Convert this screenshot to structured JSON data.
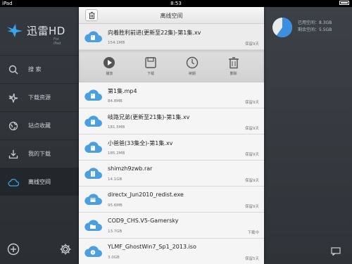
{
  "status_bar": {
    "device": "iPad",
    "time": "8:53"
  },
  "app": {
    "name": "迅雷HD",
    "subtitle": "For iPad"
  },
  "nav": [
    {
      "label": "搜    索",
      "icon": "search-icon"
    },
    {
      "label": "下载资源",
      "icon": "bird-icon"
    },
    {
      "label": "站点收藏",
      "icon": "globe-icon"
    },
    {
      "label": "我的下载",
      "icon": "download-icon"
    },
    {
      "label": "离线空间",
      "icon": "cloud-icon",
      "active": true
    }
  ],
  "storage": {
    "used_label": "已用空间：8.3GB",
    "free_label": "剩余空间：5.5GB",
    "used_fraction": 0.6
  },
  "panel": {
    "title": "离线空间",
    "actions": [
      {
        "label": "播放",
        "icon": "play-icon"
      },
      {
        "label": "下载",
        "icon": "save-icon"
      },
      {
        "label": "续期",
        "icon": "clock-icon"
      },
      {
        "label": "删除",
        "icon": "trash-icon"
      }
    ],
    "files": [
      {
        "name": "向着胜利前进(更新至22集)-第1集.xv",
        "size": "154.1MB",
        "status": "保留9天",
        "type": "video"
      },
      {
        "name": "第1集.mp4",
        "size": "84.8MB",
        "status": "保留9天",
        "type": "video"
      },
      {
        "name": "岐路兄弟(更新至21集)-第1集.xv",
        "size": "181.5MB",
        "status": "保留9天",
        "type": "video"
      },
      {
        "name": "小爸爸(33集全)-第1集.xv",
        "size": "185.2MB",
        "status": "保留9天",
        "type": "video"
      },
      {
        "name": "shimzh9zwb.rar",
        "size": "14.1GB",
        "status": "保留9天",
        "type": "archive"
      },
      {
        "name": "directx_Jun2010_redist.exe",
        "size": "95.6MB",
        "status": "保留9天",
        "type": "exe"
      },
      {
        "name": "COD9_CHS.V5-Gamersky",
        "size": "13.7GB",
        "status": "下载中",
        "type": "folder"
      },
      {
        "name": "YLMF_GhostWin7_Sp1_2013.iso",
        "size": "3.0GB",
        "status": "保留5天",
        "type": "iso"
      }
    ]
  },
  "colors": {
    "accent": "#3ba3ee",
    "sidebar": "#30363a",
    "cloud": "#4a9fe0"
  }
}
